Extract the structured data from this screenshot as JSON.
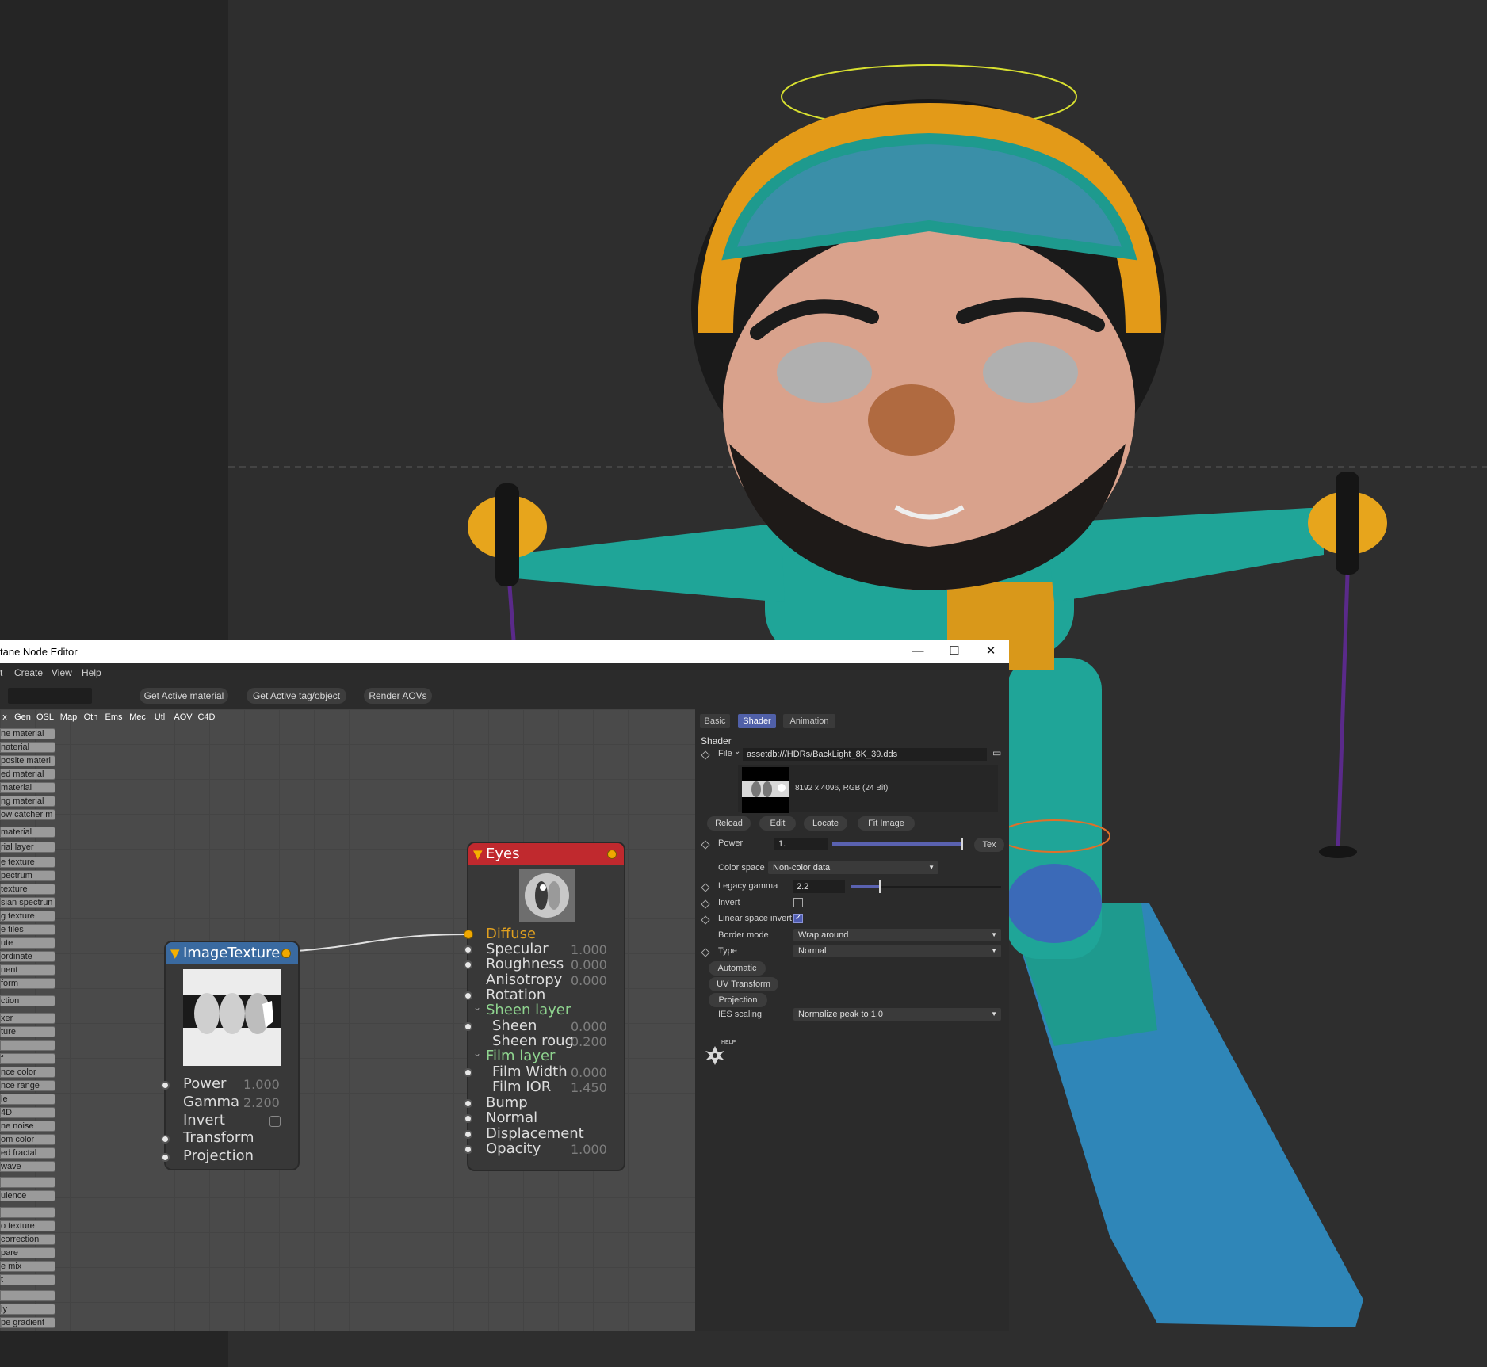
{
  "window": {
    "title": "tane Node Editor",
    "minimize": "—",
    "maximize": "☐",
    "close": "✕"
  },
  "menu": {
    "items": [
      "t",
      "Create",
      "View",
      "Help"
    ]
  },
  "toolbar": {
    "get_active_material": "Get Active material",
    "get_active_tag": "Get Active tag/object",
    "render_aovs": "Render AOVs"
  },
  "categories": [
    {
      "label": "x",
      "color": "#3a6aa8"
    },
    {
      "label": "Gen",
      "color": "#4f8a3a"
    },
    {
      "label": "OSL",
      "color": "#3a6aa8"
    },
    {
      "label": "Map",
      "color": "#a8343a"
    },
    {
      "label": "Oth",
      "color": "#555555"
    },
    {
      "label": "Ems",
      "color": "#7a3aa0"
    },
    {
      "label": "Mec",
      "color": "#2f8a8a"
    },
    {
      "label": "Utl",
      "color": "#5a8ac8"
    },
    {
      "label": "AOV",
      "color": "#6a6aa8"
    },
    {
      "label": "C4D",
      "color": "#111111"
    }
  ],
  "node_list": [
    "ne material",
    "naterial",
    "posite materi",
    "ed material",
    "material",
    "ng material",
    "ow catcher m",
    "material",
    "rial layer",
    "e texture",
    "pectrum",
    "texture",
    "sian spectrun",
    "g texture",
    "e tiles",
    "ute",
    "ordinate",
    "nent",
    "form",
    "ction",
    "xer",
    "ture",
    "",
    "f",
    "nce color",
    "nce range",
    "le",
    "4D",
    "ne noise",
    "om color",
    "ed fractal",
    "wave",
    "",
    "ulence",
    "",
    "o texture",
    " correction",
    "pare",
    "e mix",
    "t",
    "",
    "ly",
    "pe gradient"
  ],
  "node_image_texture": {
    "title": "ImageTexture",
    "inputs": [
      {
        "label": "Power",
        "value": "1.000"
      },
      {
        "label": "Gamma",
        "value": "2.200"
      },
      {
        "label": "Invert",
        "value": ""
      },
      {
        "label": "Transform",
        "value": ""
      },
      {
        "label": "Projection",
        "value": ""
      }
    ]
  },
  "node_eyes": {
    "title": "Eyes",
    "inputs": [
      {
        "label": "Diffuse",
        "value": ""
      },
      {
        "label": "Specular",
        "value": "1.000"
      },
      {
        "label": "Roughness",
        "value": "0.000"
      },
      {
        "label": "Anisotropy",
        "value": "0.000"
      },
      {
        "label": "Rotation",
        "value": ""
      },
      {
        "label": "Sheen layer",
        "value": ""
      },
      {
        "label": "Sheen",
        "value": "0.000"
      },
      {
        "label": "Sheen roug",
        "value": "0.200"
      },
      {
        "label": "Film layer",
        "value": ""
      },
      {
        "label": "Film Width",
        "value": "0.000"
      },
      {
        "label": "Film IOR",
        "value": "1.450"
      },
      {
        "label": "Bump",
        "value": ""
      },
      {
        "label": "Normal",
        "value": ""
      },
      {
        "label": "Displacement",
        "value": ""
      },
      {
        "label": "Opacity",
        "value": "1.000"
      }
    ]
  },
  "attributes": {
    "tabs": [
      "Basic",
      "Shader",
      "Animation"
    ],
    "active_tab": "Shader",
    "section": "Shader",
    "file_label": "File",
    "file_path": "assetdb:///HDRs/BackLight_8K_39.dds",
    "image_info": "8192 x 4096, RGB (24 Bit)",
    "buttons": [
      "Reload",
      "Edit",
      "Locate",
      "Fit Image"
    ],
    "power_label": "Power",
    "power_value": "1.",
    "power_level": 1.0,
    "tex_button": "Tex",
    "color_space_label": "Color space",
    "color_space_value": "Non-color data",
    "legacy_gamma_label": "Legacy gamma",
    "legacy_gamma_value": "2.2",
    "legacy_gamma_level": 0.2,
    "invert_label": "Invert",
    "invert_checked": false,
    "linear_label": "Linear space invert",
    "linear_checked": true,
    "border_mode_label": "Border mode",
    "border_mode_value": "Wrap around",
    "type_label": "Type",
    "type_value": "Normal",
    "group_buttons": [
      "Automatic",
      "UV Transform",
      "Projection"
    ],
    "ies_label": "IES scaling",
    "ies_value": "Normalize peak to 1.0",
    "help_label": "HELP"
  },
  "colors": {
    "accent": "#5060a8",
    "eyes_header": "#c0292e",
    "image_texture_header": "#3a6aa0",
    "out_pin": "#f0a800"
  }
}
